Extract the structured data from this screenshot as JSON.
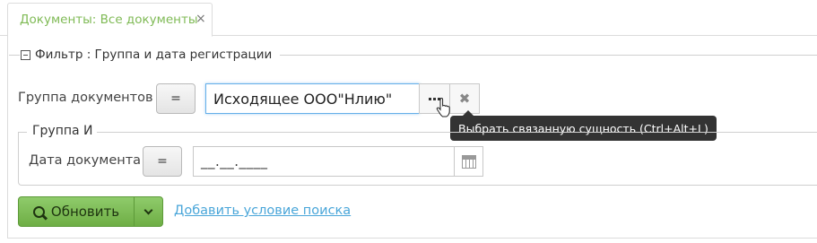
{
  "tab": {
    "title": "Документы: Все документы",
    "close_glyph": "×"
  },
  "filter": {
    "legend": "Фильтр : Группа и дата регистрации",
    "row1": {
      "label": "Группа документов",
      "operator": "=",
      "value": "Исходящее ООО\"Нлию\"",
      "select_icon": "ellipsis-icon",
      "clear_glyph": "✖"
    },
    "tooltip": "Выбрать связанную сущность (Ctrl+Alt+L)",
    "group": {
      "legend": "Группа И",
      "row": {
        "label": "Дата документа",
        "operator": "=",
        "value": "__.__.____",
        "calendar_icon": "calendar-icon"
      }
    }
  },
  "actions": {
    "refresh_label": "Обновить",
    "add_condition_label": "Добавить условие поиска"
  },
  "colors": {
    "accent_green": "#7fba55",
    "link_blue": "#4aa6d9",
    "tooltip_bg": "#333333"
  }
}
